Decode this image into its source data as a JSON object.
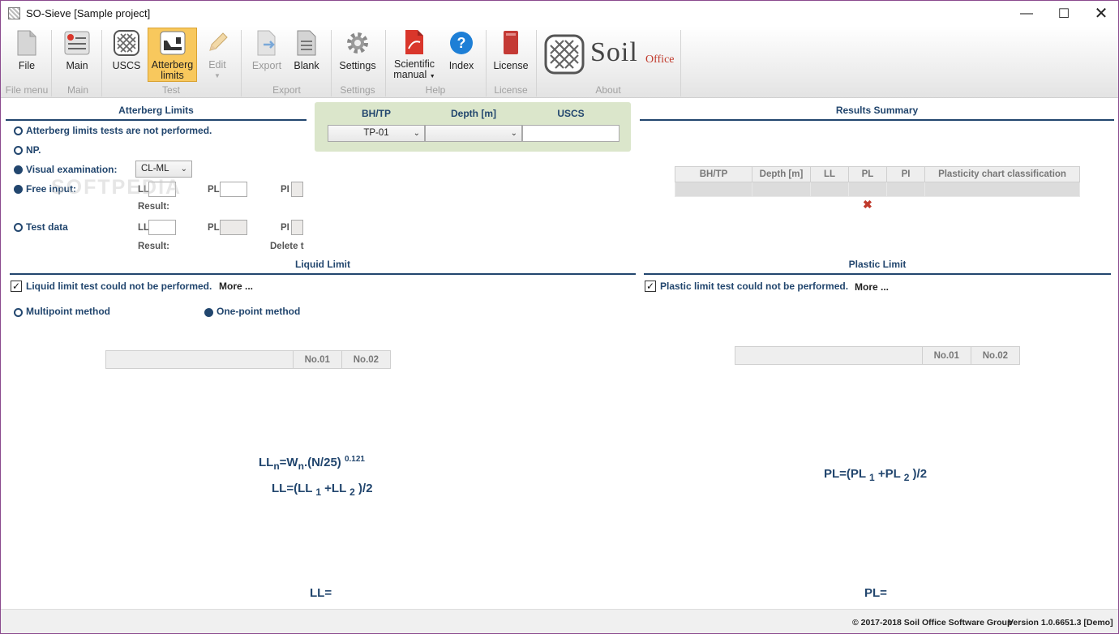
{
  "window": {
    "title": "SO-Sieve [Sample project]"
  },
  "ribbon": {
    "buttons": {
      "file": "File",
      "main": "Main",
      "uscs": "USCS",
      "atterberg_1": "Atterberg",
      "atterberg_2": "limits",
      "edit": "Edit",
      "export": "Export",
      "blank": "Blank",
      "settings": "Settings",
      "scientific_1": "Scientific",
      "scientific_2": "manual",
      "index": "Index",
      "license": "License"
    },
    "groups": {
      "file_menu": "File menu",
      "main": "Main",
      "test": "Test",
      "export": "Export",
      "settings": "Settings",
      "help": "Help",
      "license": "License",
      "about": "About"
    },
    "logo": {
      "text_main": "Soil",
      "text_office": "Office"
    }
  },
  "atterberg": {
    "title": "Atterberg Limits",
    "not_performed": "Atterberg limits tests are not performed.",
    "np": "NP.",
    "visual": "Visual examination:",
    "visual_value": "CL-ML",
    "free_input": "Free input:",
    "test_data": "Test data",
    "ll": "LL",
    "pl": "PL",
    "pi": "PI",
    "result": "Result:",
    "delete": "Delete t"
  },
  "bh": {
    "headers": {
      "bh": "BH/TP",
      "depth": "Depth [m]",
      "uscs": "USCS"
    },
    "bh_value": "TP-01",
    "depth_value": "",
    "uscs_value": ""
  },
  "results": {
    "title": "Results Summary",
    "columns": [
      "BH/TP",
      "Depth [m]",
      "LL",
      "PL",
      "PI",
      "Plasticity chart classification"
    ],
    "delete_icon": "red-x-icon"
  },
  "liquid": {
    "title": "Liquid Limit",
    "not_performed": "Liquid limit test could not be performed.",
    "more": "More ...",
    "multipoint": "Multipoint method",
    "onepoint": "One-point method",
    "col1": "No.01",
    "col2": "No.02",
    "f1_a": "LL",
    "f1_sub_n": "n",
    "f1_b": "=W",
    "f1_sub_n2": "n",
    "f1_c": ".(N/25)",
    "f1_exp": "0.121",
    "f2_a": "LL=(LL",
    "f2_s1": "1",
    "f2_b": "+LL",
    "f2_s2": "2",
    "f2_c": ")/2",
    "result": "LL="
  },
  "plastic": {
    "title": "Plastic Limit",
    "not_performed": "Plastic limit test could not be performed.",
    "more": "More ...",
    "col1": "No.01",
    "col2": "No.02",
    "f_a": "PL=(PL",
    "f_s1": "1",
    "f_b": "+PL",
    "f_s2": "2",
    "f_c": ")/2",
    "result": "PL="
  },
  "status": {
    "copyright": "© 2017-2018 Soil Office Software Group",
    "version": "Version 1.0.6651.3 [Demo]"
  },
  "watermark": "SOFTPEDIA",
  "colors": {
    "accent": "#22466e",
    "active_button": "#f8c85d",
    "bh_panel": "#dbe6cb",
    "delete_red": "#c0392b"
  }
}
